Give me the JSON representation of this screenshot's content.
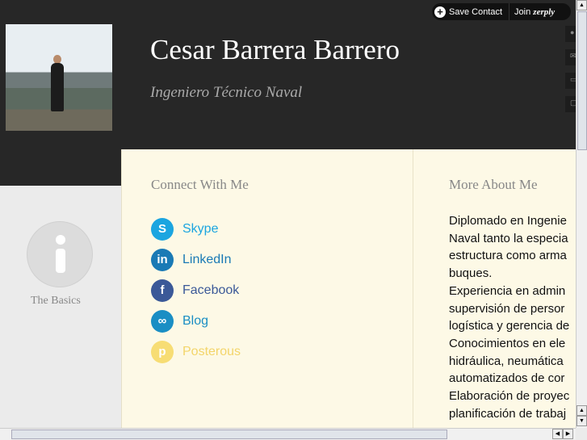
{
  "header": {
    "name": "Cesar Barrera Barrero",
    "subtitle": "Ingeniero Técnico Naval"
  },
  "topbar": {
    "save_label": "Save Contact",
    "join_label": "Join",
    "brand": "zerply"
  },
  "sidebar": {
    "basics_label": "The Basics"
  },
  "connect": {
    "title": "Connect With Me",
    "links": [
      {
        "label": "Skype",
        "icon": "skype-icon",
        "color": "#1ba5e0",
        "text_color": "#1ba5e0"
      },
      {
        "label": "LinkedIn",
        "icon": "linkedin-icon",
        "color": "#1a7ab5",
        "text_color": "#1a7ab5"
      },
      {
        "label": "Facebook",
        "icon": "facebook-icon",
        "color": "#3b5998",
        "text_color": "#3b5998"
      },
      {
        "label": "Blog",
        "icon": "link-icon",
        "color": "#1a8ec4",
        "text_color": "#1a8ec4"
      },
      {
        "label": "Posterous",
        "icon": "posterous-icon",
        "color": "#f7dd74",
        "text_color": "#f3d56a"
      }
    ]
  },
  "about": {
    "title": "More About Me",
    "lines": [
      "Diplomado en Ingenie",
      "Naval tanto la especia",
      "estructura como arma",
      "buques.",
      "Experiencia en admin",
      "supervisión de persor",
      "logística y gerencia de",
      "Conocimientos en ele",
      "hidráulica, neumática",
      "automatizados de cor",
      "Elaboración de proyec",
      "planificación de trabaj"
    ]
  }
}
